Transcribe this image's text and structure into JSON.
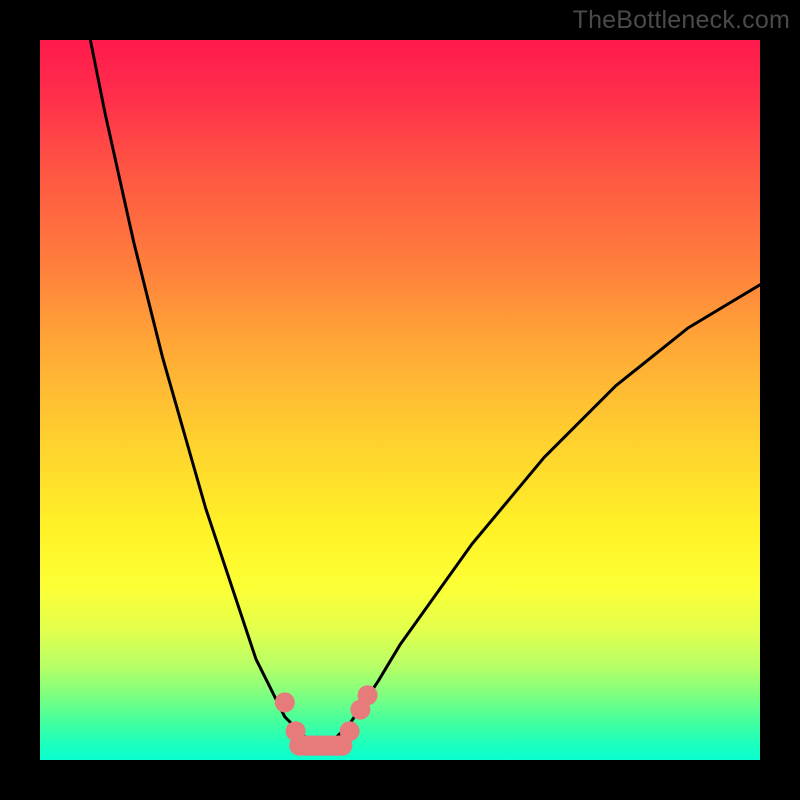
{
  "watermark": "TheBottleneck.com",
  "chart_data": {
    "type": "line",
    "title": "",
    "xlabel": "",
    "ylabel": "",
    "xlim": [
      0,
      100
    ],
    "ylim": [
      0,
      100
    ],
    "grid": false,
    "annotations": [],
    "series": [
      {
        "name": "black-curve-left",
        "color": "#000000",
        "x": [
          7,
          9,
          11,
          13,
          15,
          17,
          19,
          21,
          23,
          25,
          27,
          29,
          30,
          31,
          32,
          33,
          34,
          35,
          36,
          37,
          38,
          39
        ],
        "y": [
          100,
          90,
          81,
          72,
          64,
          56,
          49,
          42,
          35,
          29,
          23,
          17,
          14,
          12,
          10,
          8,
          6,
          5,
          4,
          3,
          2.5,
          2
        ]
      },
      {
        "name": "black-curve-right",
        "color": "#000000",
        "x": [
          39,
          40,
          41,
          42,
          43,
          45,
          47,
          50,
          55,
          60,
          65,
          70,
          75,
          80,
          85,
          90,
          95,
          100
        ],
        "y": [
          2,
          2.5,
          3,
          4,
          5,
          8,
          11,
          16,
          23,
          30,
          36,
          42,
          47,
          52,
          56,
          60,
          63,
          66
        ]
      },
      {
        "name": "pink-markers",
        "color": "#e77a7a",
        "type": "scatter",
        "x": [
          34,
          35.5,
          37,
          38.5,
          40,
          41.5,
          43,
          44.5,
          45.5
        ],
        "y": [
          8,
          4,
          2,
          2,
          2,
          2,
          4,
          7,
          9
        ]
      },
      {
        "name": "pink-bottom-segment",
        "color": "#e77a7a",
        "type": "line",
        "x": [
          36,
          37,
          38,
          39,
          40,
          41,
          42
        ],
        "y": [
          2,
          2,
          2,
          2,
          2,
          2,
          2
        ]
      }
    ],
    "gradient_bands": [
      {
        "name": "red",
        "approx_y_range": [
          70,
          100
        ]
      },
      {
        "name": "orange",
        "approx_y_range": [
          40,
          70
        ]
      },
      {
        "name": "yellow",
        "approx_y_range": [
          15,
          40
        ]
      },
      {
        "name": "yellow-green",
        "approx_y_range": [
          5,
          15
        ]
      },
      {
        "name": "green-cyan",
        "approx_y_range": [
          0,
          5
        ]
      }
    ]
  }
}
